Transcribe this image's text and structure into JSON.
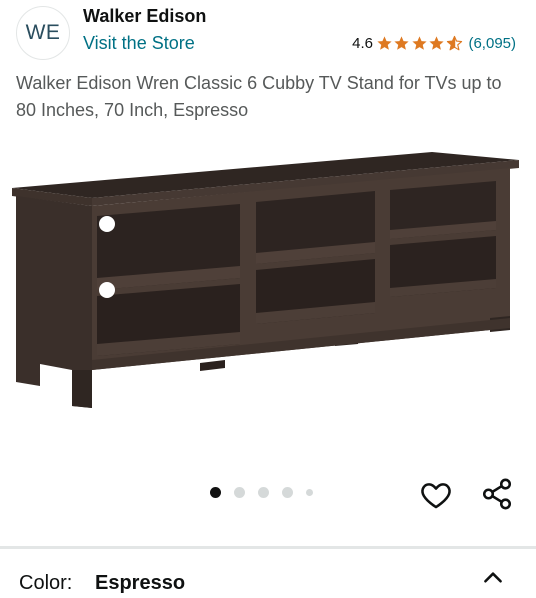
{
  "brand": {
    "logo_text": "WE",
    "name": "Walker Edison",
    "store_link": "Visit the Store"
  },
  "rating": {
    "value": "4.6",
    "stars": 4.6,
    "reviews": "(6,095)"
  },
  "product": {
    "title": "Walker Edison Wren Classic 6 Cubby TV Stand for TVs up to 80 Inches, 70 Inch, Espresso"
  },
  "carousel": {
    "total_images_dots": 5,
    "active_index": 0
  },
  "variation": {
    "label": "Color:",
    "value": "Espresso"
  },
  "colors": {
    "link": "#007185",
    "star": "#de7921",
    "text": "#0f1111",
    "muted_text": "#565959",
    "wood": "#3b302b"
  },
  "icons": {
    "wishlist": "heart-icon",
    "share": "share-icon",
    "collapse": "chevron-up-icon"
  }
}
